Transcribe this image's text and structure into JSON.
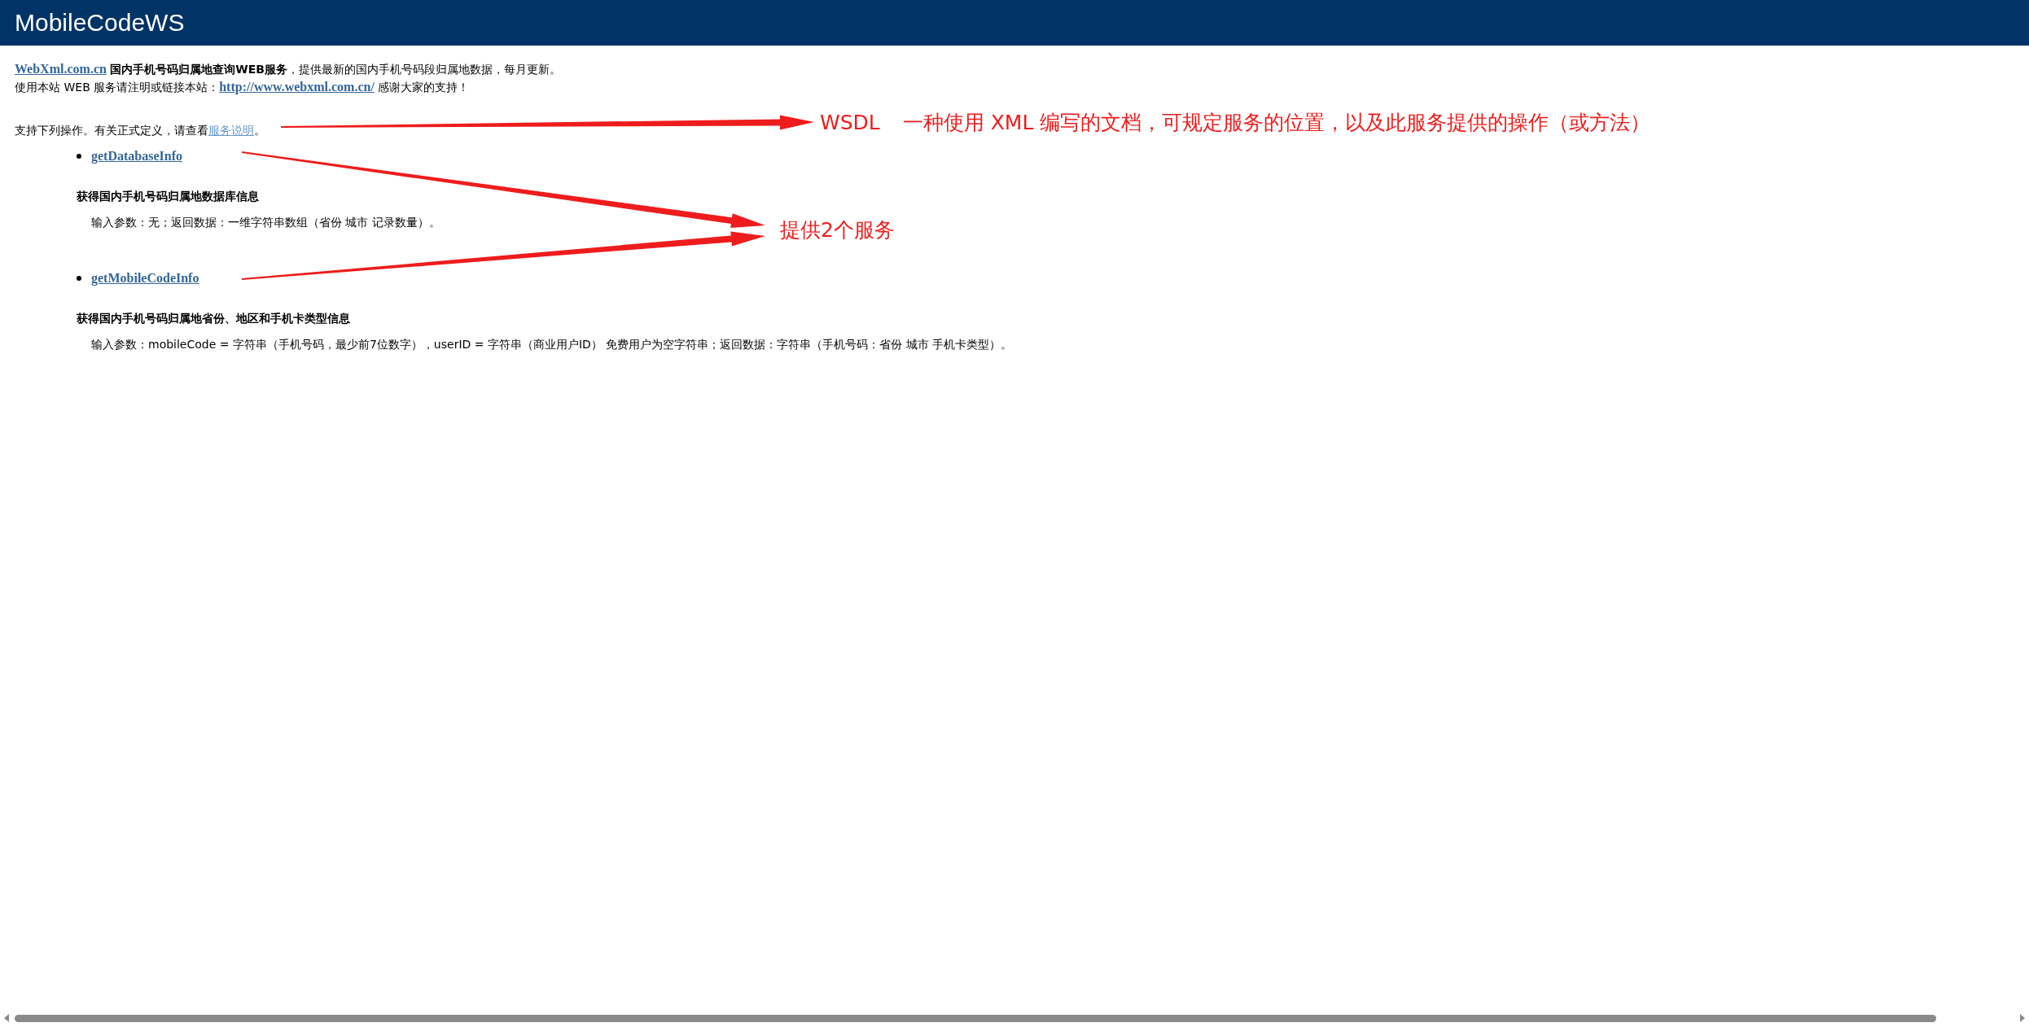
{
  "header": {
    "title": "MobileCodeWS"
  },
  "intro": [
    {
      "link": "WebXml.com.cn",
      "text": " **国内手机号码归属地查询WEB服务**，提供最新的国内手机号码段归属地数据，每月更新。",
      "kind": "link-first"
    },
    {
      "text": "使用本站 WEB 服务请注明或链接本站：",
      "link": "http://www.webxml.com.cn/",
      "after": " 感谢大家的支持！",
      "kind": "link-middle"
    }
  ],
  "support": {
    "text": "支持下列操作。有关正式定义，请查看",
    "link": "服务说明",
    "after": "。"
  },
  "operations": [
    {
      "name": "getDatabaseInfo",
      "title": "获得国内手机号码归属地数据库信息",
      "params": "输入参数：无；返回数据：一维字符串数组（省份 城市 记录数量）。"
    },
    {
      "name": "getMobileCodeInfo",
      "title": "获得国内手机号码归属地省份、地区和手机卡类型信息",
      "params": "输入参数：mobileCode = 字符串（手机号码，最少前7位数字），userID = 字符串（商业用户ID） 免费用户为空字符串；返回数据：字符串（手机号码：省份 城市 手机卡类型）。"
    }
  ],
  "annotations": [
    {
      "term": "WSDL",
      "text": "一种使用 XML 编写的文档，可规定服务的位置，以及此服务提供的操作（或方法）"
    },
    {
      "text": "提供2个服务"
    }
  ]
}
